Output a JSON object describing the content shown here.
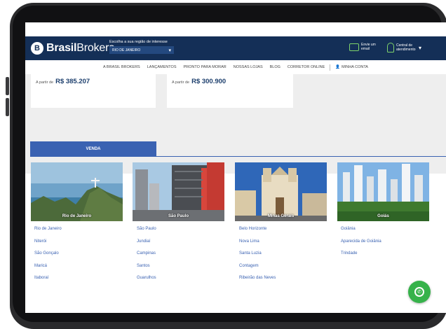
{
  "header": {
    "logo": {
      "mark": "B",
      "brand_bold": "Brasil",
      "brand_regular": "Brokers"
    },
    "region_prompt": "Escolha a sua região de interesse",
    "region_value": "RIO DE JANEIRO",
    "email_label": "Envie um email",
    "central_label": "Central de atendimento"
  },
  "menu": {
    "items": [
      "A BRASIL BROKERS",
      "LANÇAMENTOS",
      "PRONTO PARA MORAR",
      "NOSSAS LOJAS",
      "BLOG",
      "CORRETOR ONLINE",
      "MINHA CONTA"
    ]
  },
  "cards": [
    {
      "from_label": "A partir de",
      "price": "R$ 385.207"
    },
    {
      "from_label": "A partir de",
      "price": "R$ 300.900"
    }
  ],
  "tab": {
    "label": "VENDA"
  },
  "cities": [
    {
      "name": "Rio de Janeiro",
      "links": [
        "Rio de Janeiro",
        "Niterói",
        "São Gonçalo",
        "Maricá",
        "Itaboraí"
      ]
    },
    {
      "name": "São Paulo",
      "links": [
        "São Paulo",
        "Jundiaí",
        "Campinas",
        "Santos",
        "Guarulhos"
      ]
    },
    {
      "name": "Minas Gerais",
      "links": [
        "Belo Horizonte",
        "Nova Lima",
        "Santa Luzia",
        "Contagem",
        "Ribeirão das Neves"
      ]
    },
    {
      "name": "Goiás",
      "links": [
        "Goiânia",
        "Aparecida de Goiânia",
        "Trindade"
      ]
    }
  ],
  "icons": {
    "logo": "building-logo-icon",
    "email": "envelope-icon",
    "central": "headset-icon",
    "dropdown": "chevron-down-icon",
    "account": "user-icon",
    "whatsapp": "whatsapp-icon"
  },
  "colors": {
    "navbar": "#142f57",
    "tab": "#3a62b2",
    "link": "#3a62b2",
    "accent_green": "#7fd36b",
    "whatsapp": "#36b24a"
  }
}
